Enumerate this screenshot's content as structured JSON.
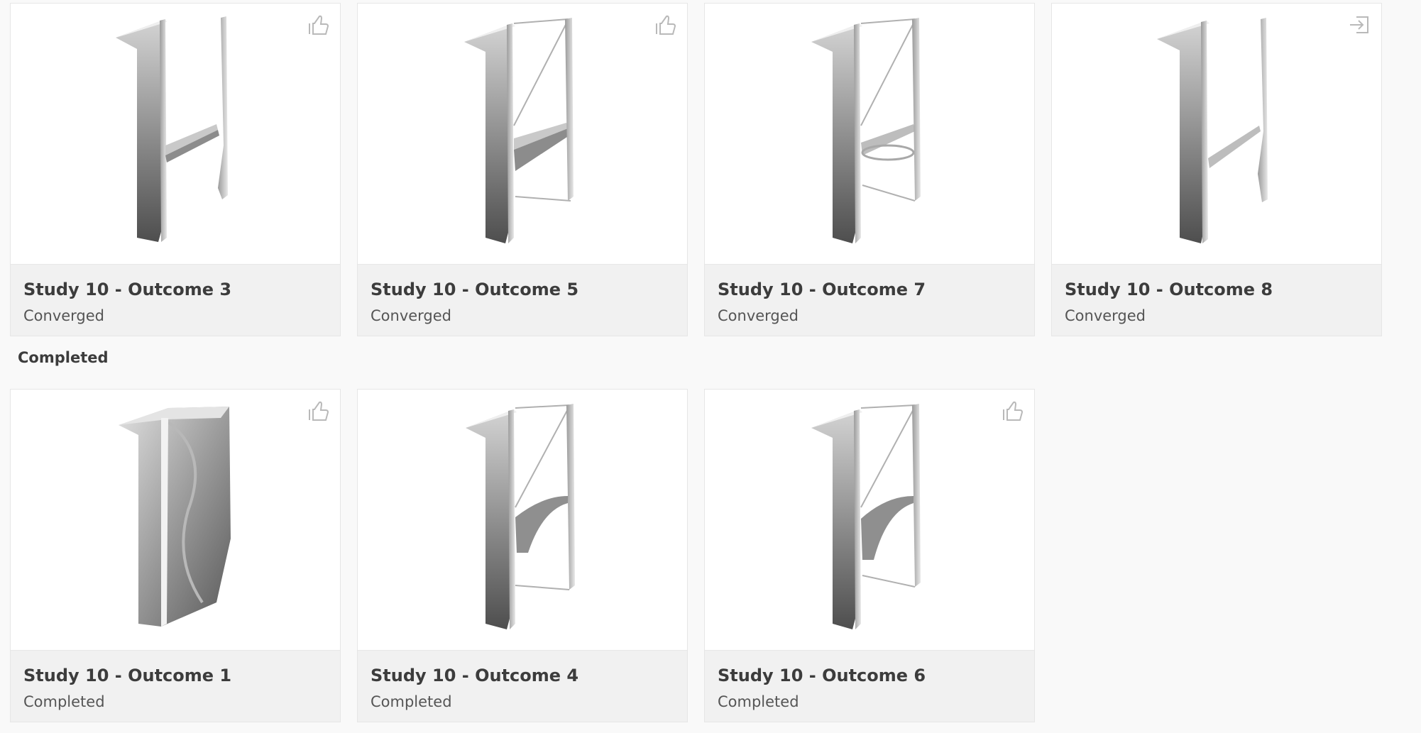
{
  "sections": [
    {
      "heading": "",
      "cards": [
        {
          "title": "Study 10 - Outcome 3",
          "status": "Converged",
          "action_icon": "thumbs-up-icon"
        },
        {
          "title": "Study 10 - Outcome 5",
          "status": "Converged",
          "action_icon": "thumbs-up-icon"
        },
        {
          "title": "Study 10 - Outcome 7",
          "status": "Converged",
          "action_icon": ""
        },
        {
          "title": "Study 10 - Outcome 8",
          "status": "Converged",
          "action_icon": "export-icon"
        }
      ]
    },
    {
      "heading": "Completed",
      "cards": [
        {
          "title": "Study 10 - Outcome 1",
          "status": "Completed",
          "action_icon": "thumbs-up-icon"
        },
        {
          "title": "Study 10 - Outcome 4",
          "status": "Completed",
          "action_icon": ""
        },
        {
          "title": "Study 10 - Outcome 6",
          "status": "Completed",
          "action_icon": "thumbs-up-icon"
        }
      ]
    }
  ],
  "colors": {
    "page_background": "#f9f9f9",
    "card_footer": "#f1f1f1",
    "thumbnail_background": "#ffffff",
    "icon_stroke": "#b9b9b9",
    "model_metal_light": "#d4d4d4",
    "model_metal_dark": "#4e4e4e"
  }
}
